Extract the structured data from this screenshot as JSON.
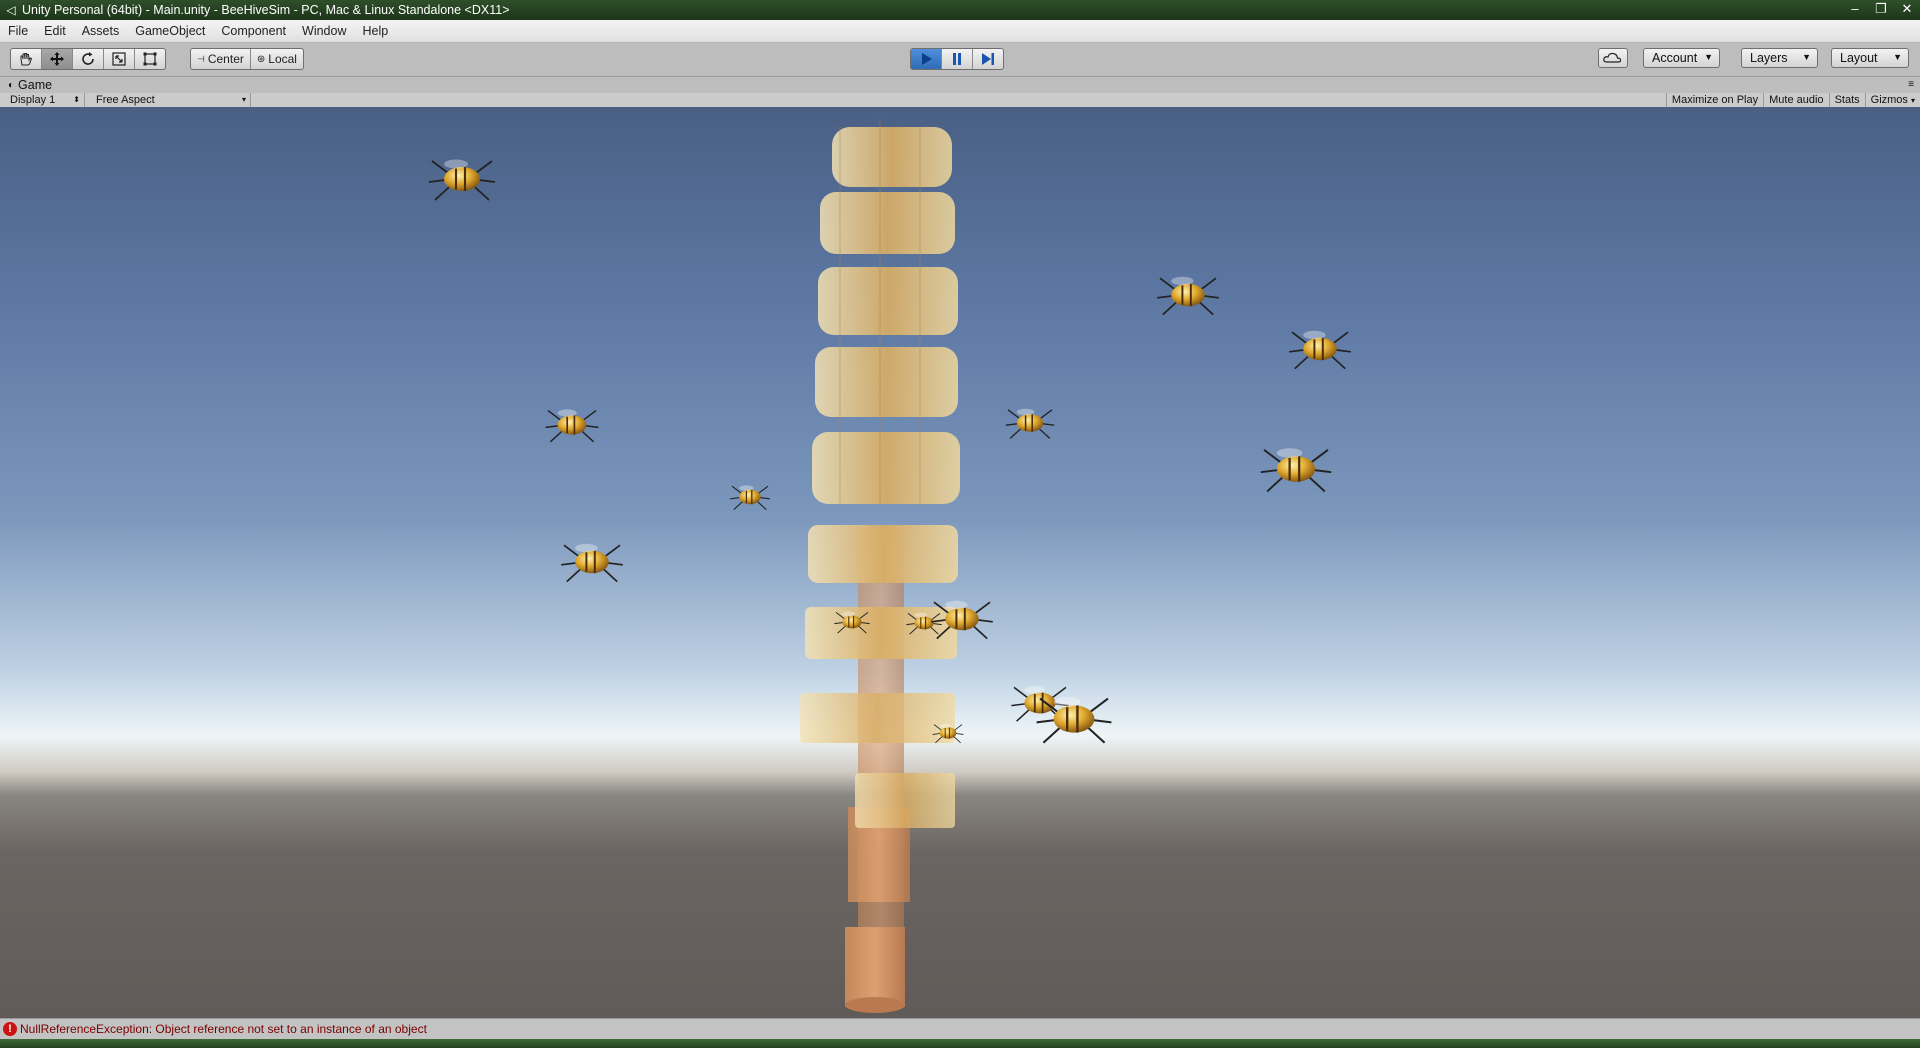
{
  "window": {
    "title": "Unity Personal (64bit) - Main.unity - BeeHiveSim - PC, Mac & Linux Standalone <DX11>",
    "controls": {
      "minimize": "–",
      "restore": "❐",
      "close": "✕"
    }
  },
  "menu": [
    "File",
    "Edit",
    "Assets",
    "GameObject",
    "Component",
    "Window",
    "Help"
  ],
  "toolbar": {
    "pivot_mode": "Center",
    "pivot_rotation": "Local",
    "account": "Account",
    "layers": "Layers",
    "layout": "Layout",
    "active_tool": "move",
    "playing": true
  },
  "game_view": {
    "tab": "Game",
    "display": "Display 1",
    "aspect": "Free Aspect",
    "toggles": [
      "Maximize on Play",
      "Mute audio",
      "Stats",
      "Gizmos"
    ]
  },
  "status": {
    "message": "NullReferenceException: Object reference not set to an instance of an object"
  },
  "colors": {
    "accent_play": "#2f6cb8",
    "error": "#c11111",
    "hive_gold": "#e6c98a"
  },
  "icons": {
    "hand_tool": "hand-icon",
    "move_tool": "move-icon",
    "rotate_tool": "rotate-icon",
    "scale_tool": "scale-icon",
    "rect_tool": "rect-icon",
    "play": "play-icon",
    "pause": "pause-icon",
    "step": "step-icon",
    "cloud": "cloud-icon"
  }
}
